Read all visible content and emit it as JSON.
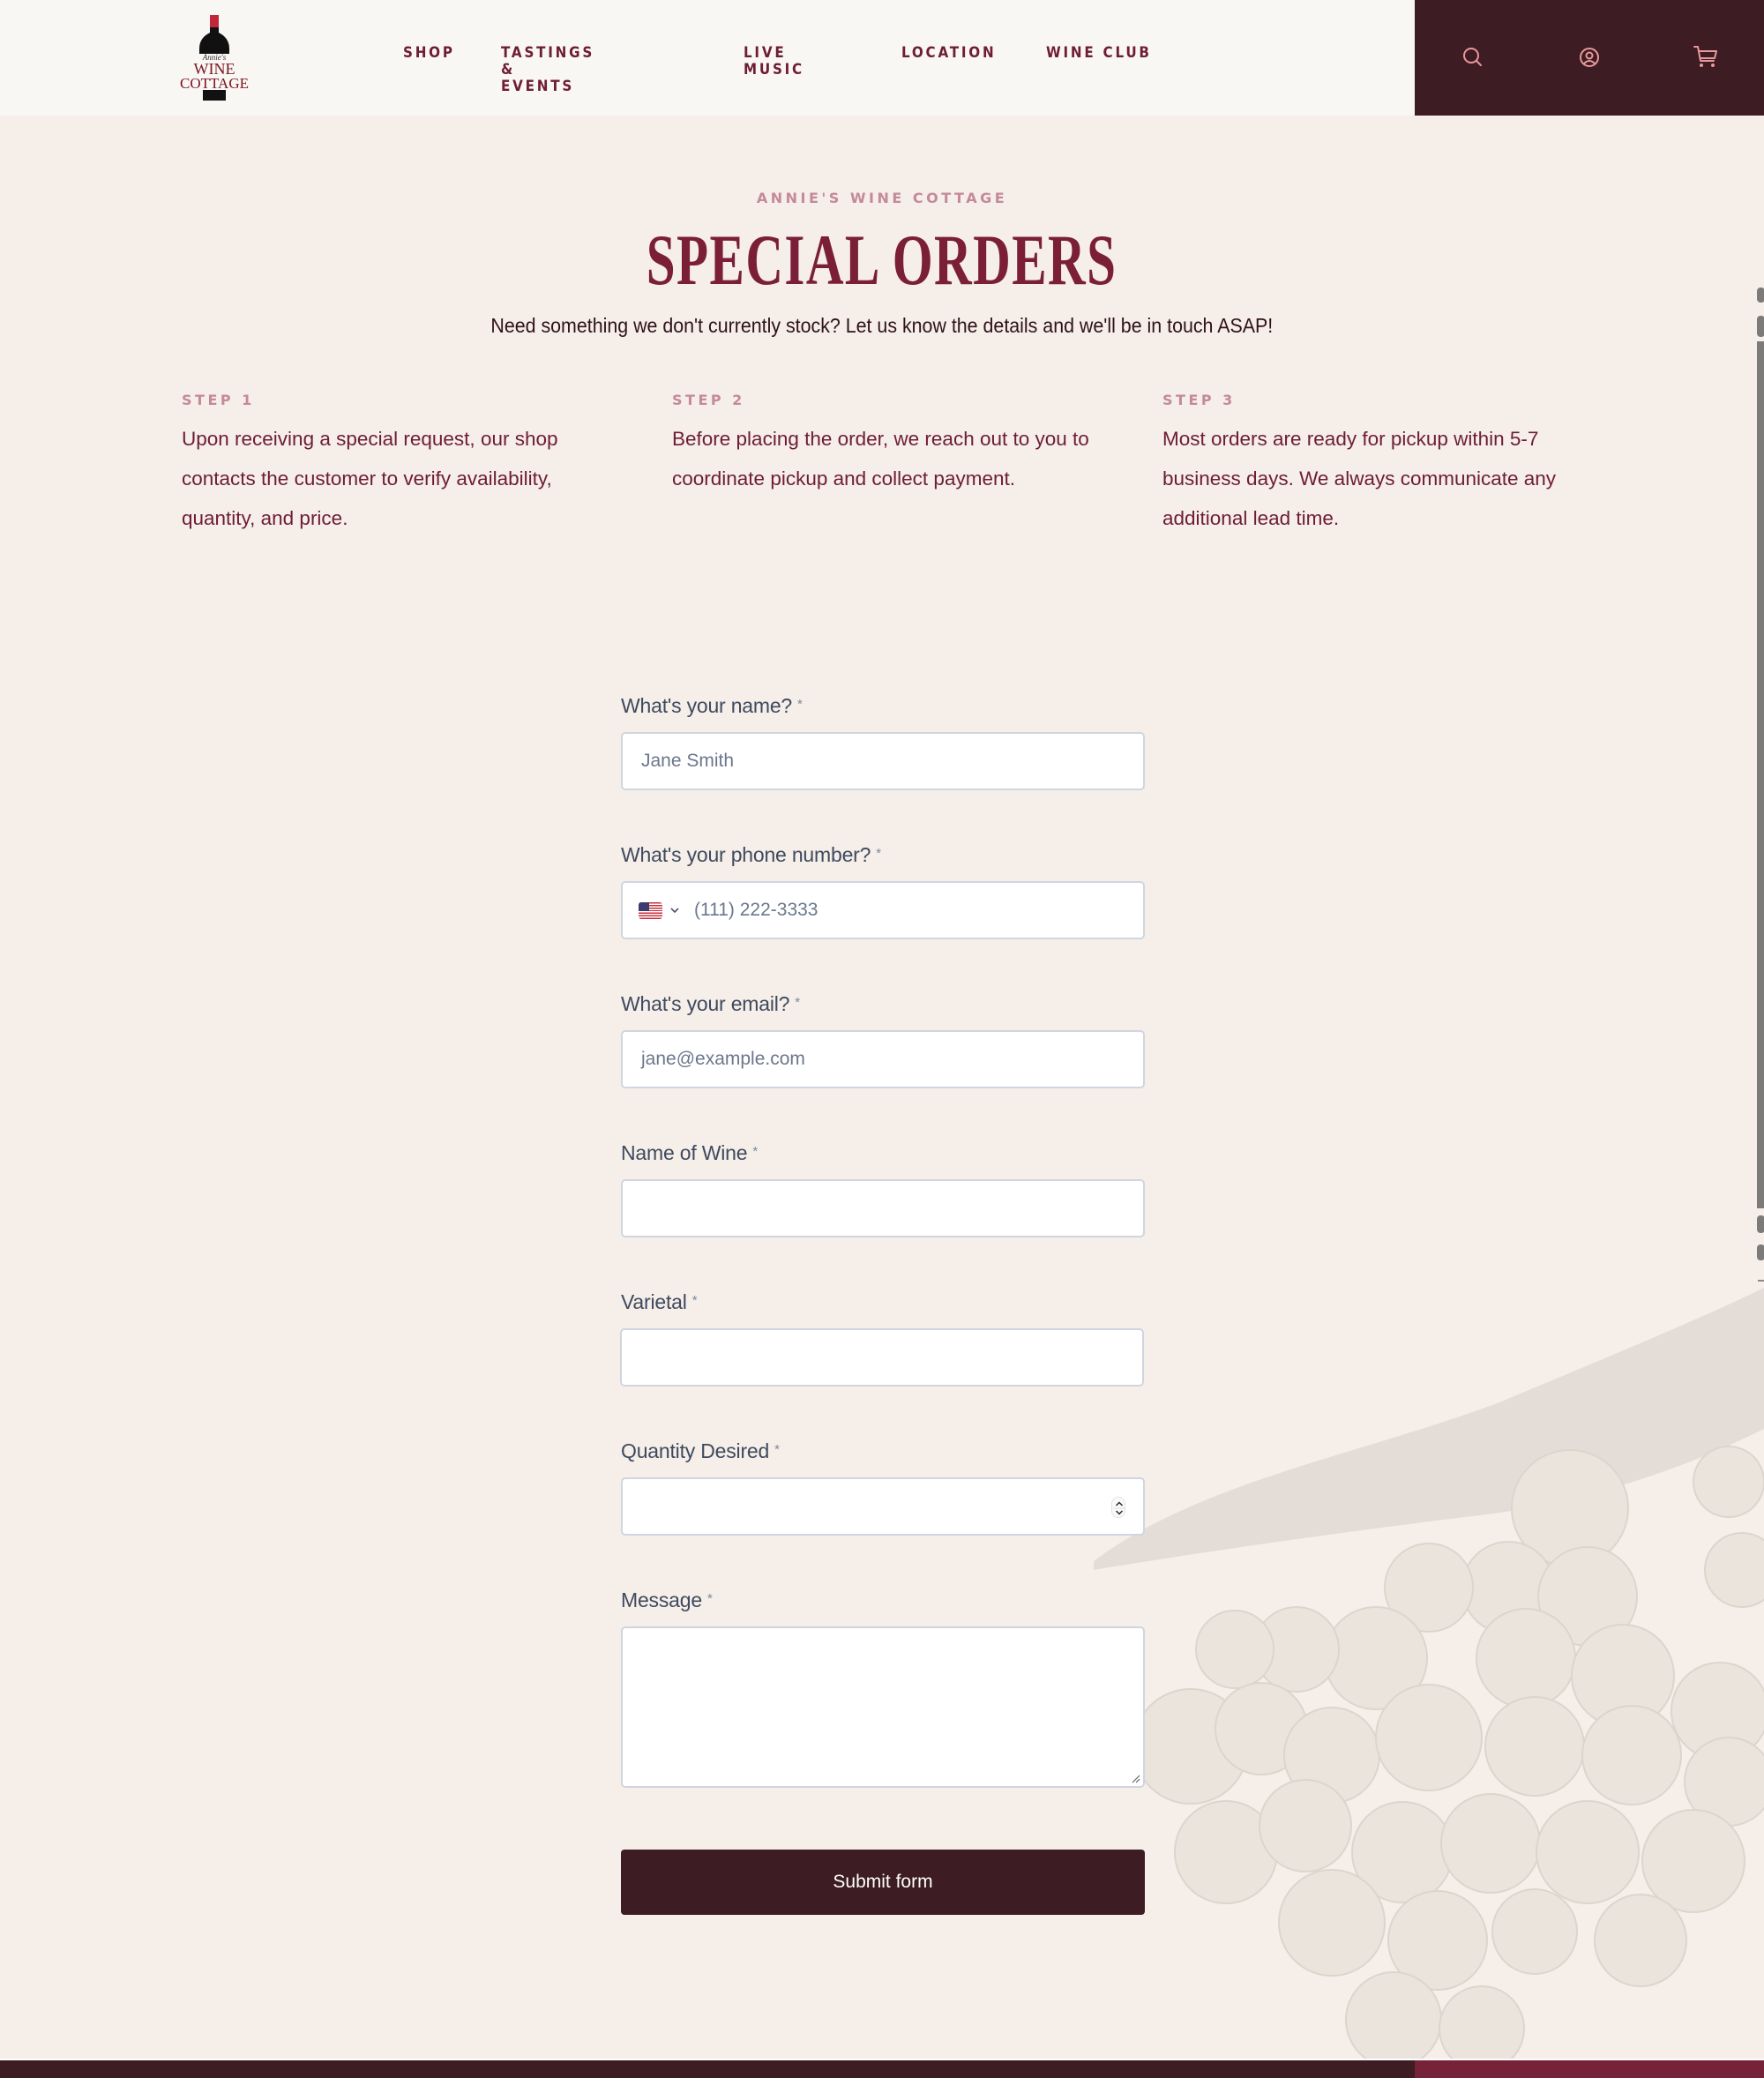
{
  "header": {
    "logo": {
      "script_text": "Annie's",
      "line1": "WINE",
      "line2": "COTTAGE"
    },
    "nav": [
      {
        "label": "SHOP"
      },
      {
        "label": "TASTINGS & EVENTS"
      },
      {
        "label": "LIVE MUSIC"
      },
      {
        "label": "LOCATION"
      },
      {
        "label": "WINE CLUB"
      }
    ],
    "actions": [
      {
        "icon": "search-icon"
      },
      {
        "icon": "account-icon"
      },
      {
        "icon": "cart-icon"
      }
    ],
    "colors": {
      "nav_text": "#6e1d34",
      "actions_bg": "#3d1c23",
      "actions_icon": "#e8999a"
    }
  },
  "hero": {
    "eyebrow": "ANNIE'S WINE COTTAGE",
    "title": "SPECIAL ORDERS",
    "subtitle": "Need something we don't currently stock? Let us know the details and we'll be in touch ASAP!"
  },
  "steps": [
    {
      "label": "STEP 1",
      "text": "Upon receiving a special request, our shop contacts the customer to verify availability, quantity, and price."
    },
    {
      "label": "STEP 2",
      "text": "Before placing the order, we reach out to you to coordinate pickup and collect payment."
    },
    {
      "label": "STEP 3",
      "text": "Most orders are ready for pickup within 5-7 business days. We always communicate any additional lead time."
    }
  ],
  "form": {
    "required_marker": "*",
    "fields": [
      {
        "label": "What's your name?",
        "placeholder": "Jane Smith",
        "value": ""
      },
      {
        "label": "What's your phone number?",
        "placeholder": "(111) 222-3333",
        "value": "",
        "country": "US"
      },
      {
        "label": "What's your email?",
        "placeholder": "jane@example.com",
        "value": ""
      },
      {
        "label": "Name of Wine",
        "placeholder": "",
        "value": ""
      },
      {
        "label": "Varietal",
        "placeholder": "",
        "value": ""
      },
      {
        "label": "Quantity Desired",
        "placeholder": "",
        "value": ""
      },
      {
        "label": "Message",
        "placeholder": "",
        "value": ""
      }
    ],
    "submit_label": "Submit form"
  },
  "theme": {
    "page_bg": "#f5eee9",
    "accent_dark": "#3d1c23",
    "accent_wine": "#7a1f36",
    "accent_pink": "#c48a98"
  }
}
